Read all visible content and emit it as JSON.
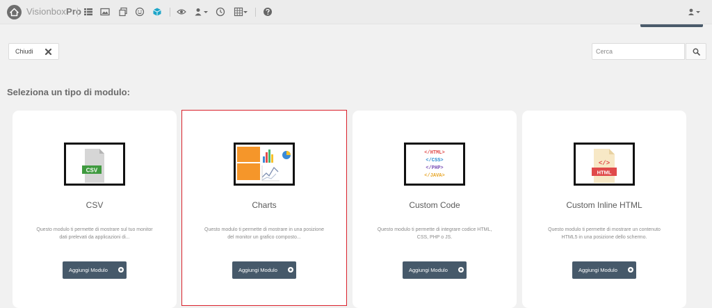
{
  "topbar": {
    "brand_light": "Visionbox",
    "brand_bold": "Pro",
    "icons": [
      "home-icon",
      "list-icon",
      "image-icon",
      "copy-icon",
      "smile-icon",
      "cube-icon",
      "eye-icon",
      "user-caret-icon",
      "clock-icon",
      "grid-caret-icon",
      "help-icon",
      "user-icon"
    ],
    "accent_cube": "#1ea5c8"
  },
  "toolbar": {
    "close_label": "Chiudi",
    "search_placeholder": "Cerca"
  },
  "section_title": "Seleziona un tipo di modulo:",
  "cards": [
    {
      "title": "CSV",
      "description": "Questo modulo ti permette di mostrare sul tuo monitor dati prelevati da applicazioni di...",
      "button_label": "Aggiungi Modulo",
      "icon": "csv-file-icon",
      "icon_text": "CSV",
      "selected": false
    },
    {
      "title": "Charts",
      "description": "Questo modulo ti permette di mostrare in una posizione del monitor un grafico composto...",
      "button_label": "Aggiungi Modulo",
      "icon": "charts-icon",
      "selected": true
    },
    {
      "title": "Custom Code",
      "description": "Questo modulo ti permette di integrare codice HTML, CSS, PHP o JS.",
      "button_label": "Aggiungi Modulo",
      "icon": "code-list-icon",
      "code_lines": [
        "</HTML>",
        "</CSS>",
        "</PHP>",
        "</JAVA>"
      ],
      "selected": false
    },
    {
      "title": "Custom Inline HTML",
      "description": "Questo modulo ti permette di mostrare un contenuto HTML5 in una posizione dello schermo.",
      "button_label": "Aggiungi Modulo",
      "icon": "html-file-icon",
      "icon_text": "HTML",
      "icon_symbol": "</>",
      "selected": false
    }
  ],
  "colors": {
    "button": "#46596a",
    "selected_border": "#d9202a",
    "csv_badge": "#3f9a3f",
    "html_badge": "#e04a4a",
    "chart_orange": "#f5962a"
  }
}
